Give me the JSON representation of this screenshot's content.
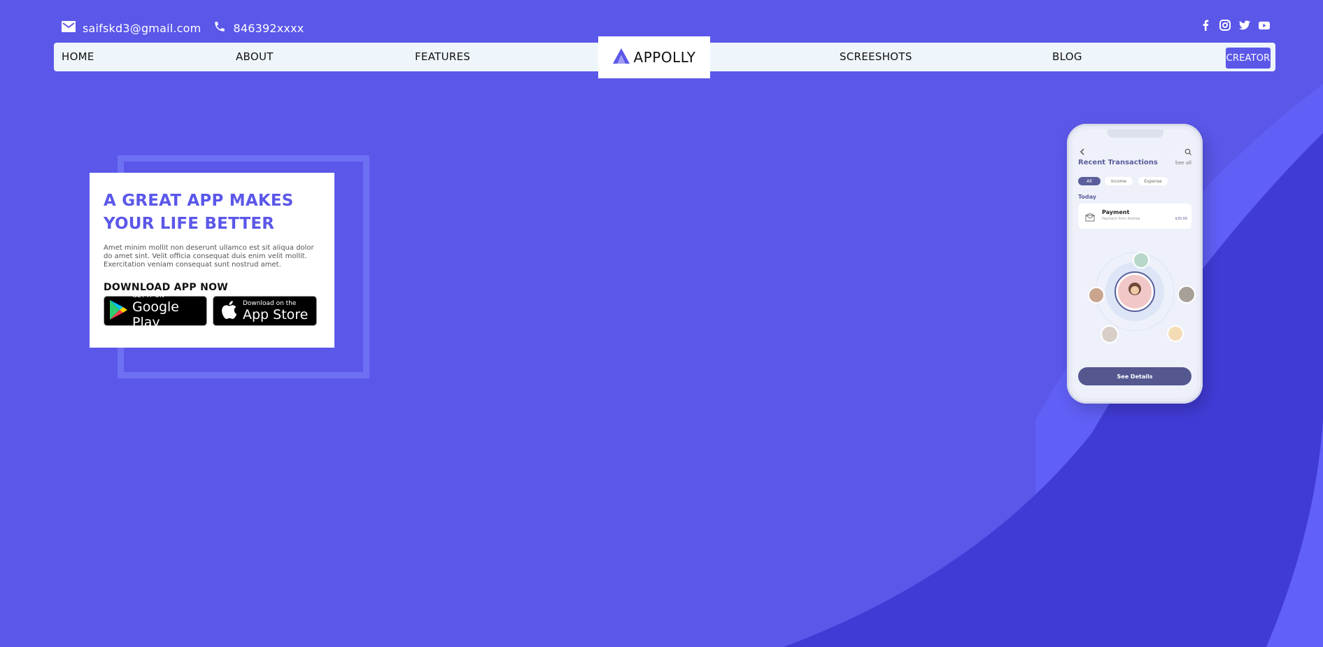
{
  "contact": {
    "email": "saifskd3@gmail.com",
    "phone": "846392xxxx"
  },
  "social": [
    "facebook-icon",
    "instagram-icon",
    "twitter-icon",
    "youtube-icon"
  ],
  "nav": {
    "home": "HOME",
    "about": "ABOUT",
    "features": "FEATURES",
    "logo": "APPOLLY",
    "screenshots": "SCREESHOTS",
    "blog": "BLOG",
    "creator": "CREATOR"
  },
  "hero": {
    "title_line1": "A GREAT APP MAKES",
    "title_line2": "YOUR LIFE BETTER",
    "description": "Amet minim mollit non deserunt ullamco est sit aliqua dolor do amet sint. Velit officia consequat duis enim velit mollit. Exercitation veniam consequat sunt nostrud amet.",
    "download_label": "DOWNLOAD APP NOW",
    "google_play": {
      "small": "GET IT ON",
      "big": "Google Play"
    },
    "app_store": {
      "small": "Download on the",
      "big": "App Store"
    }
  },
  "phone": {
    "title": "Recent Transactions",
    "see_all": "See all",
    "chips": [
      "All",
      "Income",
      "Expense"
    ],
    "today": "Today",
    "payment_title": "Payment",
    "payment_sub": "Payment from Andrea",
    "payment_amount": "$30.00",
    "button": "See Details"
  },
  "colors": {
    "background": "#5b57e9",
    "nav_bg": "#eef5fb",
    "accent": "#5b57e9"
  }
}
